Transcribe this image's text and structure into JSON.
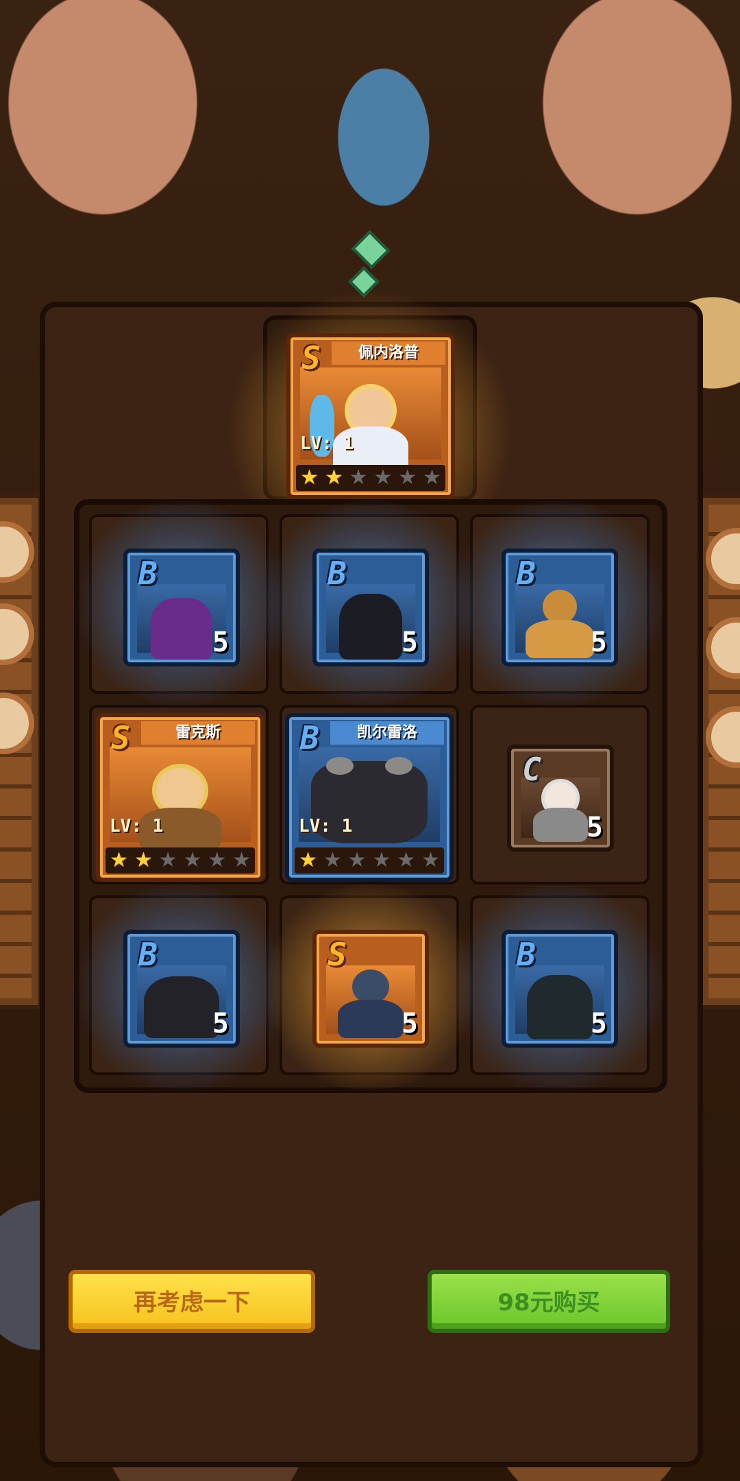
{
  "cards": {
    "top": {
      "rank": "S",
      "name": "佩内洛普",
      "level": "LV: 1",
      "stars_on": 2,
      "stars_total": 6
    },
    "grid": [
      {
        "rank": "B",
        "count": "5"
      },
      {
        "rank": "B",
        "count": "5"
      },
      {
        "rank": "B",
        "count": "5"
      },
      {
        "rank": "S",
        "name": "雷克斯",
        "level": "LV: 1",
        "stars_on": 2,
        "stars_total": 6
      },
      {
        "rank": "B",
        "name": "凯尔雷洛",
        "level": "LV: 1",
        "stars_on": 1,
        "stars_total": 6
      },
      {
        "rank": "C",
        "count": "5"
      },
      {
        "rank": "B",
        "count": "5"
      },
      {
        "rank": "S",
        "count": "5"
      },
      {
        "rank": "B",
        "count": "5"
      }
    ]
  },
  "buttons": {
    "reconsider": "再考虑一下",
    "buy": "98元购买"
  },
  "colors": {
    "rank_s": "#ffb42a",
    "rank_b": "#66aef5",
    "rank_c": "#d0d0d0",
    "button_yellow": "#f6c21d",
    "button_green": "#6ac62a"
  },
  "icons": {
    "star_filled": "star-filled-icon",
    "star_empty": "star-empty-icon"
  }
}
